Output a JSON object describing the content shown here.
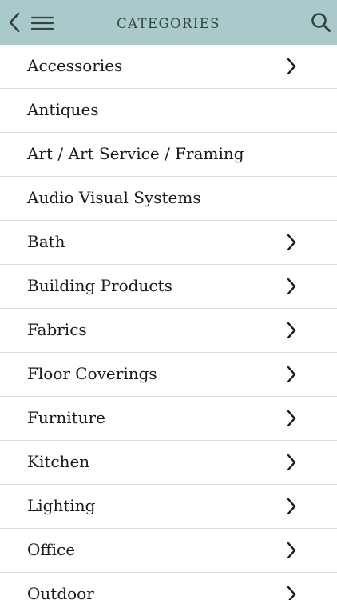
{
  "header": {
    "title": "CATEGORIES",
    "colors": {
      "background": "#a9c9cb",
      "icon": "#33433f"
    },
    "icons": [
      "chevron-left-icon",
      "hamburger-menu-icon",
      "search-icon"
    ]
  },
  "categories": [
    {
      "label": "Accessories",
      "has_children": true
    },
    {
      "label": "Antiques",
      "has_children": false
    },
    {
      "label": "Art / Art Service / Framing",
      "has_children": false
    },
    {
      "label": "Audio Visual Systems",
      "has_children": false
    },
    {
      "label": "Bath",
      "has_children": true
    },
    {
      "label": "Building Products",
      "has_children": true
    },
    {
      "label": "Fabrics",
      "has_children": true
    },
    {
      "label": "Floor Coverings",
      "has_children": true
    },
    {
      "label": "Furniture",
      "has_children": true
    },
    {
      "label": "Kitchen",
      "has_children": true
    },
    {
      "label": "Lighting",
      "has_children": true
    },
    {
      "label": "Office",
      "has_children": true
    },
    {
      "label": "Outdoor",
      "has_children": true
    }
  ]
}
